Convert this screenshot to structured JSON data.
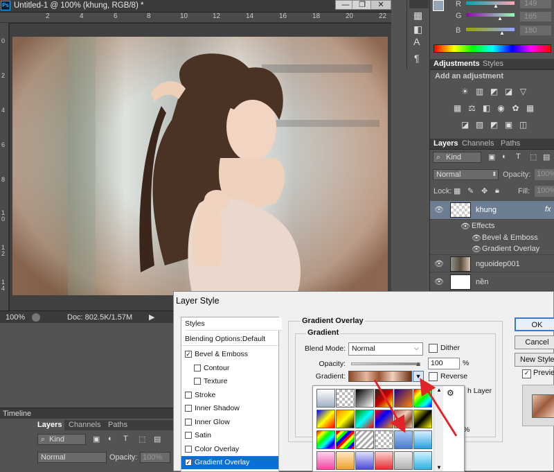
{
  "document": {
    "tab_title": "Untitled-1 @ 100% (khung, RGB/8) *",
    "ps_logo": "Ps",
    "ruler_top": [
      "2",
      "4",
      "6",
      "8",
      "10",
      "12",
      "14",
      "16",
      "18",
      "20",
      "22"
    ],
    "ruler_left": [
      "0",
      "2",
      "4",
      "6",
      "8",
      "1\n0",
      "1\n2",
      "1\n4"
    ],
    "zoom": "100%",
    "doc_info": "Doc: 802.5K/1.57M"
  },
  "window_controls": {
    "minimize": "—",
    "maximize": "❐",
    "close": "✕"
  },
  "timeline": {
    "label": "Timeline"
  },
  "mini_layers": {
    "tabs": [
      "Layers",
      "Channels",
      "Paths"
    ],
    "kind": "Kind",
    "blend": "Normal",
    "opacity_label": "Opacity:",
    "opacity_value": "100%"
  },
  "color_panel": {
    "rows": [
      {
        "label": "R",
        "value": "149"
      },
      {
        "label": "G",
        "value": "165"
      },
      {
        "label": "B",
        "value": "180"
      }
    ]
  },
  "adjustments": {
    "tabs": [
      "Adjustments",
      "Styles"
    ],
    "heading": "Add an adjustment"
  },
  "layers_panel": {
    "tabs": [
      "Layers",
      "Channels",
      "Paths"
    ],
    "kind": "Kind",
    "blend_mode": "Normal",
    "opacity_label": "Opacity:",
    "opacity_value": "100%",
    "lock_label": "Lock:",
    "fill_label": "Fill:",
    "fill_value": "100%",
    "layers": [
      {
        "name": "khung",
        "fx": "fx",
        "effects_label": "Effects",
        "effects": [
          "Bevel & Emboss",
          "Gradient Overlay"
        ]
      },
      {
        "name": "nguoidep001"
      },
      {
        "name": "nền"
      }
    ]
  },
  "dialog": {
    "title": "Layer Style",
    "styles_header": "Styles",
    "blending_options": "Blending Options:Default",
    "style_items": [
      {
        "label": "Bevel & Emboss",
        "checked": "✓",
        "indent": false
      },
      {
        "label": "Contour",
        "checked": "",
        "indent": true
      },
      {
        "label": "Texture",
        "checked": "",
        "indent": true
      },
      {
        "label": "Stroke",
        "checked": "",
        "indent": false
      },
      {
        "label": "Inner Shadow",
        "checked": "",
        "indent": false
      },
      {
        "label": "Inner Glow",
        "checked": "",
        "indent": false
      },
      {
        "label": "Satin",
        "checked": "",
        "indent": false
      },
      {
        "label": "Color Overlay",
        "checked": "",
        "indent": false
      },
      {
        "label": "Gradient Overlay",
        "checked": "✓",
        "indent": false,
        "selected": true
      }
    ],
    "section_title": "Gradient Overlay",
    "subsection_title": "Gradient",
    "blend_mode_label": "Blend Mode:",
    "blend_mode_value": "Normal",
    "dither_label": "Dither",
    "opacity_label": "Opacity:",
    "opacity_value": "100",
    "percent": "%",
    "gradient_label": "Gradient:",
    "reverse_label": "Reverse",
    "align_partial": "h Layer",
    "percent_partial": "%",
    "ok": "OK",
    "cancel": "Cancel",
    "new_style": "New Style...",
    "preview": "Preview",
    "preview_checked": "✓"
  },
  "colors": {
    "selected_blue": "#0a6fd6",
    "accent_red": "#e0242a",
    "layer_selected": "#6d7d92"
  }
}
